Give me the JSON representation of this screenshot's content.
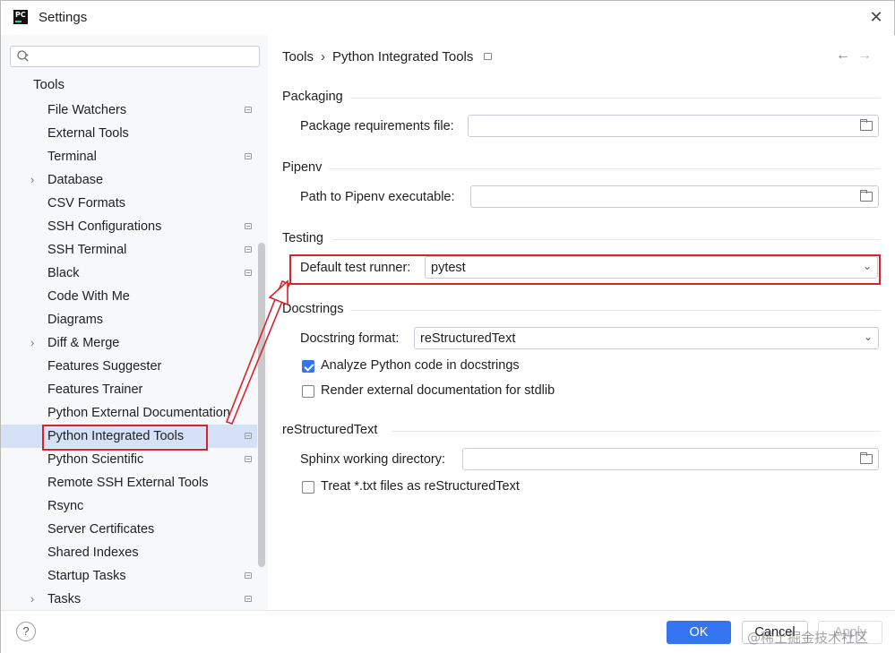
{
  "window": {
    "title": "Settings"
  },
  "sidebar": {
    "search": {
      "value": "",
      "placeholder": ""
    },
    "root_label": "Tools",
    "items": [
      {
        "label": "File Watchers",
        "expandable": false,
        "has_icon": true
      },
      {
        "label": "External Tools",
        "expandable": false,
        "has_icon": false
      },
      {
        "label": "Terminal",
        "expandable": false,
        "has_icon": true
      },
      {
        "label": "Database",
        "expandable": true,
        "has_icon": false
      },
      {
        "label": "CSV Formats",
        "expandable": false,
        "has_icon": false
      },
      {
        "label": "SSH Configurations",
        "expandable": false,
        "has_icon": true
      },
      {
        "label": "SSH Terminal",
        "expandable": false,
        "has_icon": true
      },
      {
        "label": "Black",
        "expandable": false,
        "has_icon": true
      },
      {
        "label": "Code With Me",
        "expandable": false,
        "has_icon": false
      },
      {
        "label": "Diagrams",
        "expandable": false,
        "has_icon": false
      },
      {
        "label": "Diff & Merge",
        "expandable": true,
        "has_icon": false
      },
      {
        "label": "Features Suggester",
        "expandable": false,
        "has_icon": false
      },
      {
        "label": "Features Trainer",
        "expandable": false,
        "has_icon": false
      },
      {
        "label": "Python External Documentation",
        "expandable": false,
        "has_icon": false
      },
      {
        "label": "Python Integrated Tools",
        "expandable": false,
        "has_icon": true,
        "selected": true
      },
      {
        "label": "Python Scientific",
        "expandable": false,
        "has_icon": true
      },
      {
        "label": "Remote SSH External Tools",
        "expandable": false,
        "has_icon": false
      },
      {
        "label": "Rsync",
        "expandable": false,
        "has_icon": false
      },
      {
        "label": "Server Certificates",
        "expandable": false,
        "has_icon": false
      },
      {
        "label": "Shared Indexes",
        "expandable": false,
        "has_icon": false
      },
      {
        "label": "Startup Tasks",
        "expandable": false,
        "has_icon": true
      },
      {
        "label": "Tasks",
        "expandable": true,
        "has_icon": true
      }
    ]
  },
  "breadcrumb": {
    "parent": "Tools",
    "separator": "›",
    "current": "Python Integrated Tools"
  },
  "nav": {
    "back": "←",
    "forward": "→"
  },
  "sections": {
    "packaging": {
      "title": "Packaging",
      "requirements_label": "Package requirements file:",
      "requirements_value": ""
    },
    "pipenv": {
      "title": "Pipenv",
      "path_label": "Path to Pipenv executable:",
      "path_value": ""
    },
    "testing": {
      "title": "Testing",
      "runner_label": "Default test runner:",
      "runner_value": "pytest"
    },
    "docstrings": {
      "title": "Docstrings",
      "format_label": "Docstring format:",
      "format_value": "reStructuredText",
      "analyze_label": "Analyze Python code in docstrings",
      "analyze_checked": true,
      "render_label": "Render external documentation for stdlib",
      "render_checked": false
    },
    "restructured": {
      "title": "reStructuredText",
      "sphinx_label": "Sphinx working directory:",
      "sphinx_value": "",
      "treat_label": "Treat *.txt files as reStructuredText",
      "treat_checked": false
    }
  },
  "footer": {
    "help": "?",
    "ok": "OK",
    "cancel": "Cancel",
    "apply": "Apply"
  },
  "watermark": "@稀土掘金技术社区",
  "colors": {
    "accent": "#3574f0",
    "annotation": "#d9232c",
    "selection": "#d5e1f7",
    "sidebar_bg": "#f7f8fa"
  }
}
